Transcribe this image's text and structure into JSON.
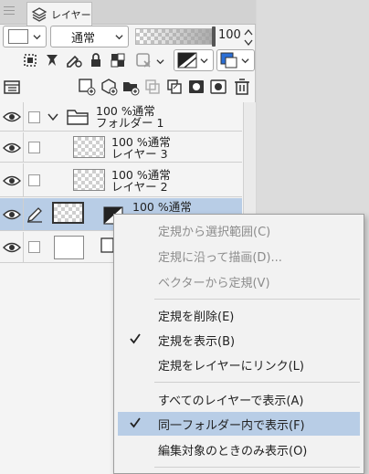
{
  "palette": {
    "tab_label": "レイヤー",
    "blend_mode": "通常",
    "opacity": "100",
    "opacity_fraction": 1.0
  },
  "layers": [
    {
      "opacity_mode": "100 %通常",
      "name": "フォルダー 1",
      "kind": "folder"
    },
    {
      "opacity_mode": "100 %通常",
      "name": "レイヤー 3",
      "kind": "raster"
    },
    {
      "opacity_mode": "100 %通常",
      "name": "レイヤー 2",
      "kind": "raster"
    },
    {
      "opacity_mode": "100 %通常",
      "name": "",
      "kind": "ruler",
      "selected": true
    },
    {
      "opacity_mode": "",
      "name": "",
      "kind": "paper"
    }
  ],
  "context_menu": {
    "items": [
      {
        "label": "定規から選択範囲(C)",
        "disabled": true,
        "checked": false
      },
      {
        "label": "定規に沿って描画(D)...",
        "disabled": true,
        "checked": false
      },
      {
        "label": "ベクターから定規(V)",
        "disabled": true,
        "checked": false
      },
      {
        "label": "定規を削除(E)",
        "disabled": false,
        "checked": false
      },
      {
        "label": "定規を表示(B)",
        "disabled": false,
        "checked": true
      },
      {
        "label": "定規をレイヤーにリンク(L)",
        "disabled": false,
        "checked": false
      },
      {
        "label": "すべてのレイヤーで表示(A)",
        "disabled": false,
        "checked": false
      },
      {
        "label": "同一フォルダー内で表示(F)",
        "disabled": false,
        "checked": true,
        "highlighted": true
      },
      {
        "label": "編集対象のときのみ表示(O)",
        "disabled": false,
        "checked": false
      }
    ]
  },
  "colors": {
    "selection": "#b8cde6",
    "accent_blue": "#2b6fd6"
  }
}
